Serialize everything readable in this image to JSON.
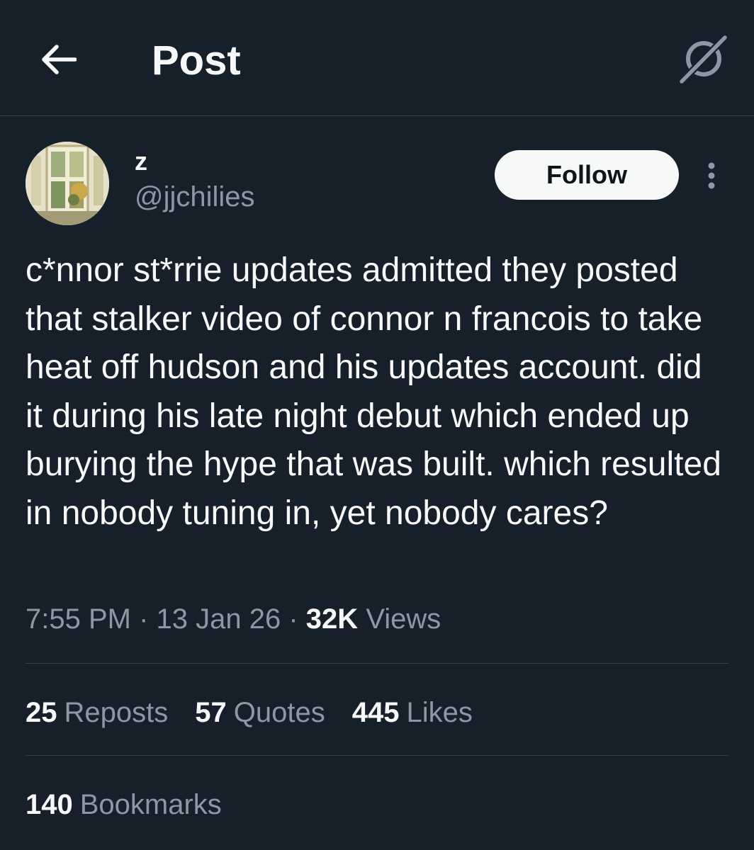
{
  "header": {
    "title": "Post",
    "back_icon": "arrow-left-icon",
    "grok_icon": "grok-icon"
  },
  "author": {
    "name": "z",
    "handle": "@jjchilies",
    "follow_label": "Follow",
    "more_icon": "more-vertical-icon"
  },
  "tweet": {
    "text": "c*nnor st*rrie updates admitted they posted that stalker video of connor n francois to take heat off hudson and his updates account. did it during his late night debut which ended up burying the hype that was built. which resulted in nobody tuning in, yet nobody cares?",
    "time": "7:55 PM",
    "date": "13 Jan 26",
    "views_count": "32K",
    "views_label": "Views"
  },
  "stats": {
    "reposts_count": "25",
    "reposts_label": "Reposts",
    "quotes_count": "57",
    "quotes_label": "Quotes",
    "likes_count": "445",
    "likes_label": "Likes",
    "bookmarks_count": "140",
    "bookmarks_label": "Bookmarks"
  },
  "colors": {
    "background": "#15202b",
    "text": "#f7f9f9",
    "secondary": "#8b98a5",
    "divider": "#38444d"
  }
}
